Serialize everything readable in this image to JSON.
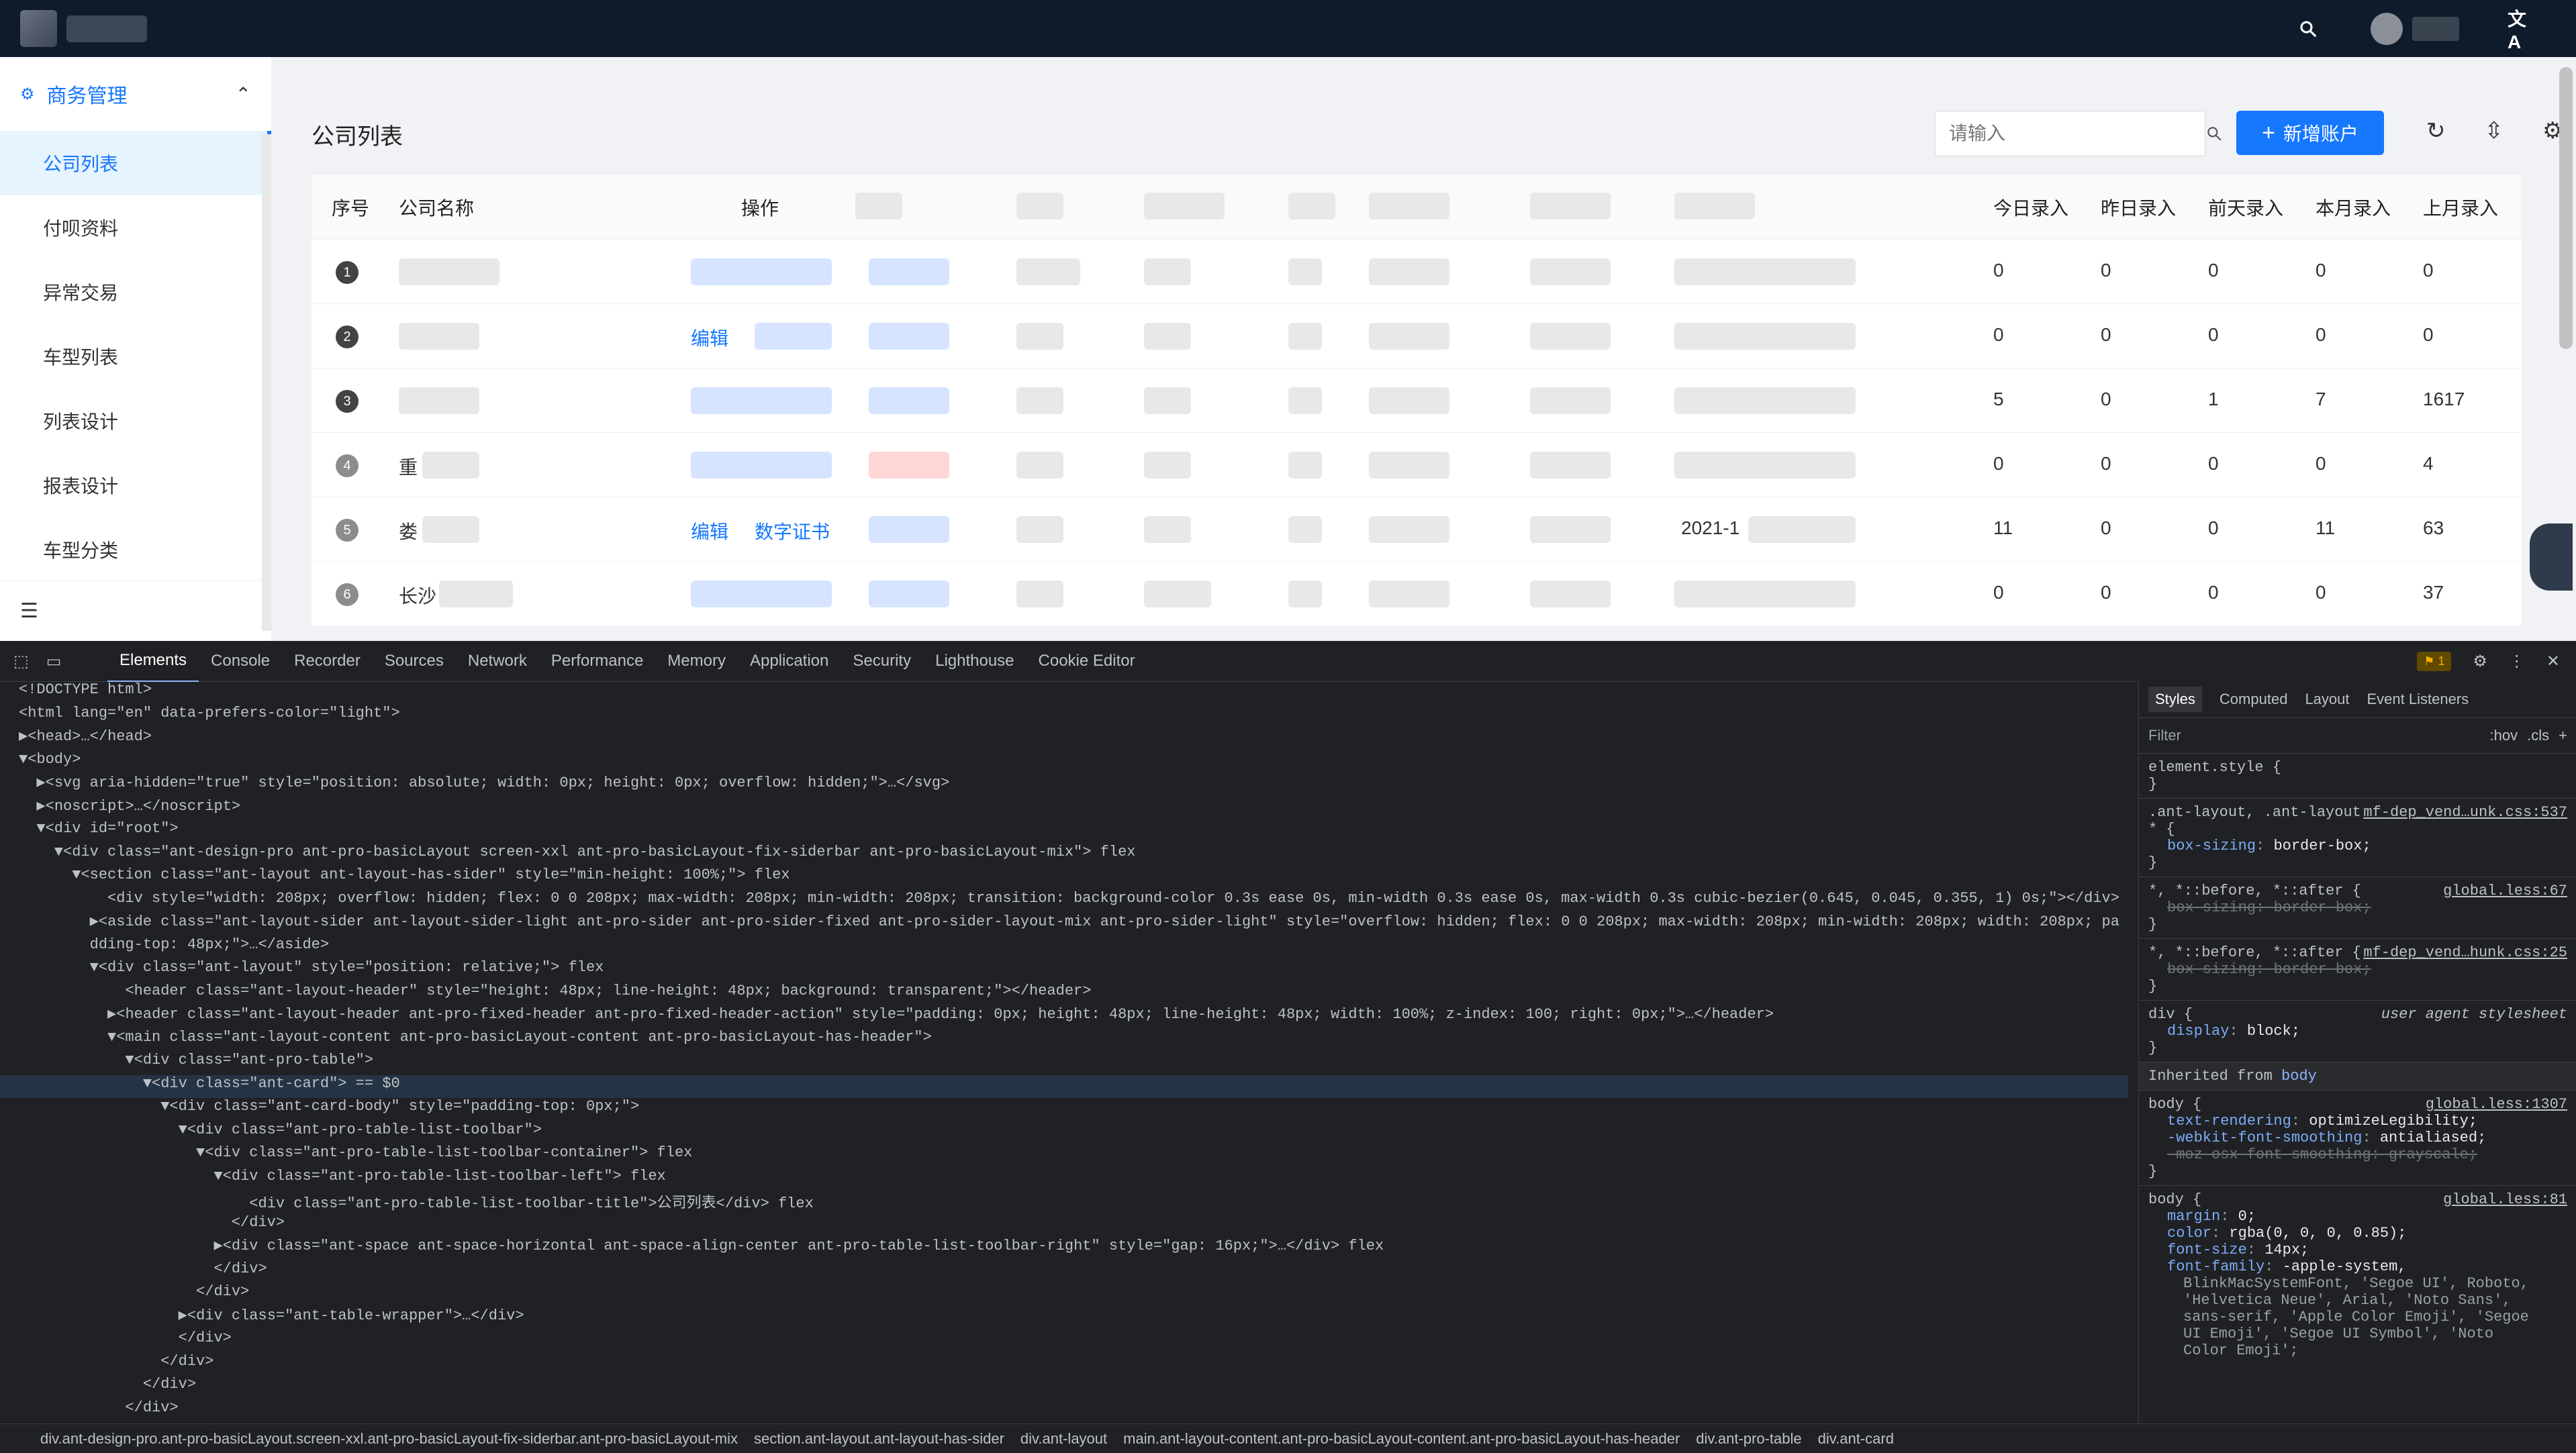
{
  "header": {
    "language_icon": "translate-icon"
  },
  "sidebar": {
    "group_label": "商务管理",
    "items": [
      {
        "label": "公司列表"
      },
      {
        "label": "付呗资料"
      },
      {
        "label": "异常交易"
      },
      {
        "label": "车型列表"
      },
      {
        "label": "列表设计"
      },
      {
        "label": "报表设计"
      },
      {
        "label": "车型分类"
      }
    ]
  },
  "main": {
    "title": "公司列表",
    "search": {
      "placeholder": "请输入"
    },
    "add_button_label": "新增账户",
    "table": {
      "columns": {
        "seq": "序号",
        "company": "公司名称",
        "action": "操作",
        "today": "今日录入",
        "yesterday": "昨日录入",
        "day_before": "前天录入",
        "this_month": "本月录入",
        "last_month": "上月录入"
      },
      "rows": [
        {
          "seq": "1",
          "company": "",
          "op1": "",
          "op2": "",
          "date": "",
          "today": "0",
          "yesterday": "0",
          "day_before": "0",
          "this_month": "0",
          "last_month": "0"
        },
        {
          "seq": "2",
          "company": "",
          "op1": "编辑",
          "op2": "",
          "date": "",
          "today": "0",
          "yesterday": "0",
          "day_before": "0",
          "this_month": "0",
          "last_month": "0"
        },
        {
          "seq": "3",
          "company": "",
          "op1": "",
          "op2": "",
          "date": "",
          "today": "5",
          "yesterday": "0",
          "day_before": "1",
          "this_month": "7",
          "last_month": "1617"
        },
        {
          "seq": "4",
          "company": "重",
          "op1": "",
          "op2": "",
          "date": "",
          "today": "0",
          "yesterday": "0",
          "day_before": "0",
          "this_month": "0",
          "last_month": "4"
        },
        {
          "seq": "5",
          "company": "娄",
          "op1": "编辑",
          "op2": "数字证书",
          "date": "2021-1",
          "today": "11",
          "yesterday": "0",
          "day_before": "0",
          "this_month": "11",
          "last_month": "63"
        },
        {
          "seq": "6",
          "company": "长沙",
          "op1": "",
          "op2": "",
          "date": "",
          "today": "0",
          "yesterday": "0",
          "day_before": "0",
          "this_month": "0",
          "last_month": "37"
        }
      ]
    }
  },
  "devtools": {
    "tabs": [
      "Elements",
      "Console",
      "Recorder",
      "Sources",
      "Network",
      "Performance",
      "Memory",
      "Application",
      "Security",
      "Lighthouse",
      "Cookie Editor"
    ],
    "active_tab": "Elements",
    "warning_count": "1",
    "code_lines": [
      "<!DOCTYPE html>",
      "<html lang=\"en\" data-prefers-color=\"light\">",
      "▶<head>…</head>",
      "▼<body>",
      "  ▶<svg aria-hidden=\"true\" style=\"position: absolute; width: 0px; height: 0px; overflow: hidden;\">…</svg>",
      "  ▶<noscript>…</noscript>",
      "  ▼<div id=\"root\">",
      "    ▼<div class=\"ant-design-pro ant-pro-basicLayout screen-xxl ant-pro-basicLayout-fix-siderbar ant-pro-basicLayout-mix\"> flex",
      "      ▼<section class=\"ant-layout ant-layout-has-sider\" style=\"min-height: 100%;\"> flex",
      "          <div style=\"width: 208px; overflow: hidden; flex: 0 0 208px; max-width: 208px; min-width: 208px; transition: background-color 0.3s ease 0s, min-width 0.3s ease 0s, max-width 0.3s cubic-bezier(0.645, 0.045, 0.355, 1) 0s;\"></div>",
      "        ▶<aside class=\"ant-layout-sider ant-layout-sider-light ant-pro-sider ant-pro-sider-fixed ant-pro-sider-layout-mix ant-pro-sider-light\" style=\"overflow: hidden; flex: 0 0 208px; max-width: 208px; min-width: 208px; width: 208px; pa",
      "        dding-top: 48px;\">…</aside>",
      "        ▼<div class=\"ant-layout\" style=\"position: relative;\"> flex",
      "            <header class=\"ant-layout-header\" style=\"height: 48px; line-height: 48px; background: transparent;\"></header>",
      "          ▶<header class=\"ant-layout-header ant-pro-fixed-header ant-pro-fixed-header-action\" style=\"padding: 0px; height: 48px; line-height: 48px; width: 100%; z-index: 100; right: 0px;\">…</header>",
      "          ▼<main class=\"ant-layout-content ant-pro-basicLayout-content ant-pro-basicLayout-has-header\">",
      "            ▼<div class=\"ant-pro-table\">",
      "              ▼<div class=\"ant-card\"> == $0",
      "                ▼<div class=\"ant-card-body\" style=\"padding-top: 0px;\">",
      "                  ▼<div class=\"ant-pro-table-list-toolbar\">",
      "                    ▼<div class=\"ant-pro-table-list-toolbar-container\"> flex",
      "                      ▼<div class=\"ant-pro-table-list-toolbar-left\"> flex",
      "                          <div class=\"ant-pro-table-list-toolbar-title\">公司列表</div> flex",
      "                        </div>",
      "                      ▶<div class=\"ant-space ant-space-horizontal ant-space-align-center ant-pro-table-list-toolbar-right\" style=\"gap: 16px;\">…</div> flex",
      "                      </div>",
      "                    </div>",
      "                  ▶<div class=\"ant-table-wrapper\">…</div>",
      "                  </div>",
      "                </div>",
      "              </div>",
      "            </div>",
      "          </main>"
    ],
    "styles": {
      "tabs": [
        "Styles",
        "Computed",
        "Layout",
        "Event Listeners"
      ],
      "filter_placeholder": "Filter",
      "hov": ":hov",
      "cls": ".cls",
      "rules": [
        {
          "selector": "element.style {",
          "source": "",
          "props": []
        },
        {
          "selector": ".ant-layout, .ant-layout * {",
          "source": "mf-dep_vend…unk.css:537",
          "props": [
            [
              "box-sizing",
              "border-box;",
              false
            ]
          ]
        },
        {
          "selector": "*, *::before, *::after {",
          "source": "global.less:67",
          "props": [
            [
              "box-sizing",
              "border-box;",
              true
            ]
          ]
        },
        {
          "selector": "*, *::before, *::after {",
          "source": "mf-dep_vend…hunk.css:25",
          "props": [
            [
              "box-sizing",
              "border-box;",
              true
            ]
          ]
        },
        {
          "selector": "div {",
          "source": "user agent stylesheet",
          "props": [
            [
              "display",
              "block;",
              false
            ]
          ]
        }
      ],
      "inherited_label": "Inherited from",
      "inherited_from": "body",
      "body_rule_source": "global.less:1307",
      "body_props": [
        [
          "text-rendering",
          "optimizeLegibility;"
        ],
        [
          "-webkit-font-smoothing",
          "antialiased;"
        ]
      ],
      "body_strike": "-moz-osx-font-smoothing: grayscale;",
      "body2_source": "global.less:81",
      "body2_props": [
        [
          "margin",
          "0;"
        ],
        [
          "color",
          "rgba(0, 0, 0, 0.85);"
        ],
        [
          "font-size",
          "14px;"
        ],
        [
          "font-family",
          "-apple-system,"
        ]
      ],
      "font_stack_lines": [
        "BlinkMacSystemFont, 'Segoe UI', Roboto,",
        "'Helvetica Neue', Arial, 'Noto Sans',",
        "sans-serif, 'Apple Color Emoji', 'Segoe",
        "UI Emoji', 'Segoe UI Symbol', 'Noto",
        "Color Emoji';"
      ]
    },
    "breadcrumbs": [
      "div.ant-design-pro.ant-pro-basicLayout.screen-xxl.ant-pro-basicLayout-fix-siderbar.ant-pro-basicLayout-mix",
      "section.ant-layout.ant-layout-has-sider",
      "div.ant-layout",
      "main.ant-layout-content.ant-pro-basicLayout-content.ant-pro-basicLayout-has-header",
      "div.ant-pro-table",
      "div.ant-card"
    ]
  }
}
